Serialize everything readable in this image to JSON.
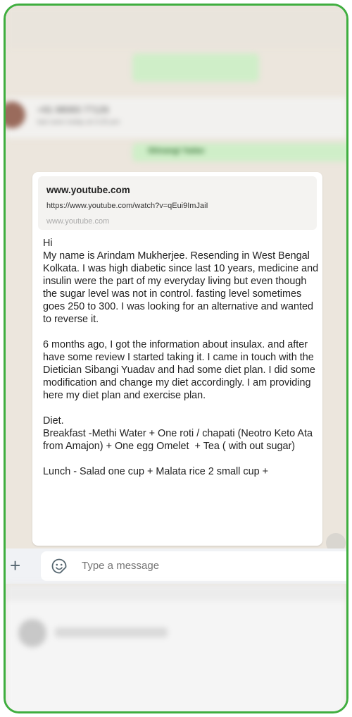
{
  "contact": {
    "name": "+91 98083 77126",
    "status": "last seen today at 3:25 pm"
  },
  "tag": {
    "label": "Shivangi Yadav"
  },
  "link_preview": {
    "title": "www.youtube.com",
    "url": "https://www.youtube.com/watch?v=qEui9ImJaiI",
    "domain": "www.youtube.com"
  },
  "message": {
    "text": "Hi\nMy name is Arindam Mukherjee. Resending in West Bengal Kolkata. I was high diabetic since last 10 years, medicine and insulin were the part of my everyday living but even though the sugar level was not in control. fasting level sometimes goes 250 to 300. I was looking for an alternative and wanted to reverse it.\n\n6 months ago, I got the information about insulax. and after have some review I started taking it. I came in touch with the Dietician Sibangi Yuadav and had some diet plan. I did some modification and change my diet accordingly. I am providing here my diet plan and exercise plan.\n\nDiet.\nBreakfast -Methi Water + One roti / chapati (Neotro Keto Ata from Amajon) + One egg Omelet  + Tea ( with out sugar)\n\nLunch - Salad one cup + Malata rice 2 small cup +"
  },
  "composer": {
    "placeholder": "Type a message"
  },
  "icons": {
    "plus": "plus-icon",
    "sticker": "sticker-icon"
  },
  "colors": {
    "frame_border": "#3fae3f",
    "outgoing_bubble": "#cfeec8",
    "chat_bg": "#ece6dd"
  }
}
